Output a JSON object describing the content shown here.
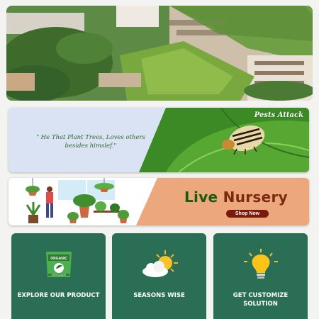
{
  "hero": {
    "alt": "Green rooftop gardens"
  },
  "banners": {
    "pest": {
      "tag": "Pests Attack",
      "quote": "\" He That Plant Trees, Loves others besides himslef.\""
    },
    "nursery": {
      "title_word1": "Live",
      "title_word2": "Nursery",
      "cta": "Shop Now"
    }
  },
  "cards": [
    {
      "label": "EXPLORE OUR PRODUCT",
      "icon": "fertilizer-bag-icon",
      "icon_text": "ORGANIC",
      "icon_subtext": "FERTILIZER"
    },
    {
      "label": "SEASONS WISE",
      "icon": "sun-cloud-icon"
    },
    {
      "label": "GET CUSTOMIZE SOLUTION",
      "icon": "lightbulb-icon"
    }
  ],
  "colors": {
    "card_bg": "#2a6e55",
    "nursery_accent": "#eda77c",
    "cta_bg": "#7a1a0a"
  }
}
